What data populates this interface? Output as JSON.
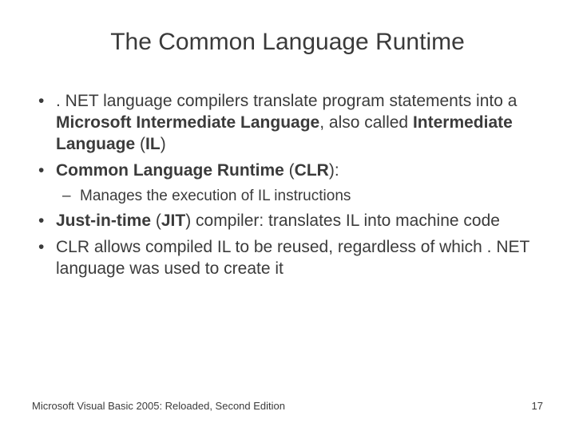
{
  "title": "The Common Language Runtime",
  "bullets": {
    "b1_a": ". NET language compilers translate program statements into a ",
    "b1_bold1": "Microsoft Intermediate Language",
    "b1_b": ", also called ",
    "b1_bold2": "Intermediate Language",
    "b1_c": " (",
    "b1_bold3": "IL",
    "b1_d": ")",
    "b2_bold1": "Common Language Runtime",
    "b2_a": " (",
    "b2_bold2": "CLR",
    "b2_b": "):",
    "b2_sub1": "Manages the execution of IL instructions",
    "b3_bold1": "Just-in-time",
    "b3_a": " (",
    "b3_bold2": "JIT",
    "b3_b": ") compiler: translates IL into machine code",
    "b4": "CLR allows compiled IL to be reused, regardless of which . NET language was used to create it"
  },
  "footer": {
    "left": "Microsoft Visual Basic 2005: Reloaded, Second Edition",
    "right": "17"
  }
}
